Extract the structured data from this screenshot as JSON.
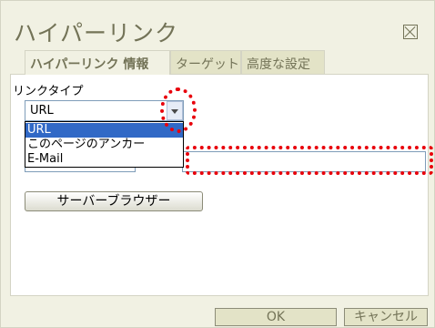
{
  "dialog": {
    "title": "ハイパーリンク"
  },
  "tabs": [
    {
      "label": "ハイパーリンク 情報",
      "active": true
    },
    {
      "label": "ターゲット",
      "active": false
    },
    {
      "label": "高度な設定",
      "active": false
    }
  ],
  "link_type": {
    "label": "リンクタイプ",
    "selected": "URL",
    "options": [
      "URL",
      "このページのアンカー",
      "E-Mail"
    ]
  },
  "browse_button": "サーバーブラウザー",
  "footer": {
    "ok": "OK",
    "cancel": "キャンセル"
  },
  "colors": {
    "accent": "#737357",
    "selection": "#3169c6",
    "highlight": "#e8000b"
  },
  "icons": {
    "close": "close-icon",
    "dropdown": "chevron-down-icon"
  }
}
